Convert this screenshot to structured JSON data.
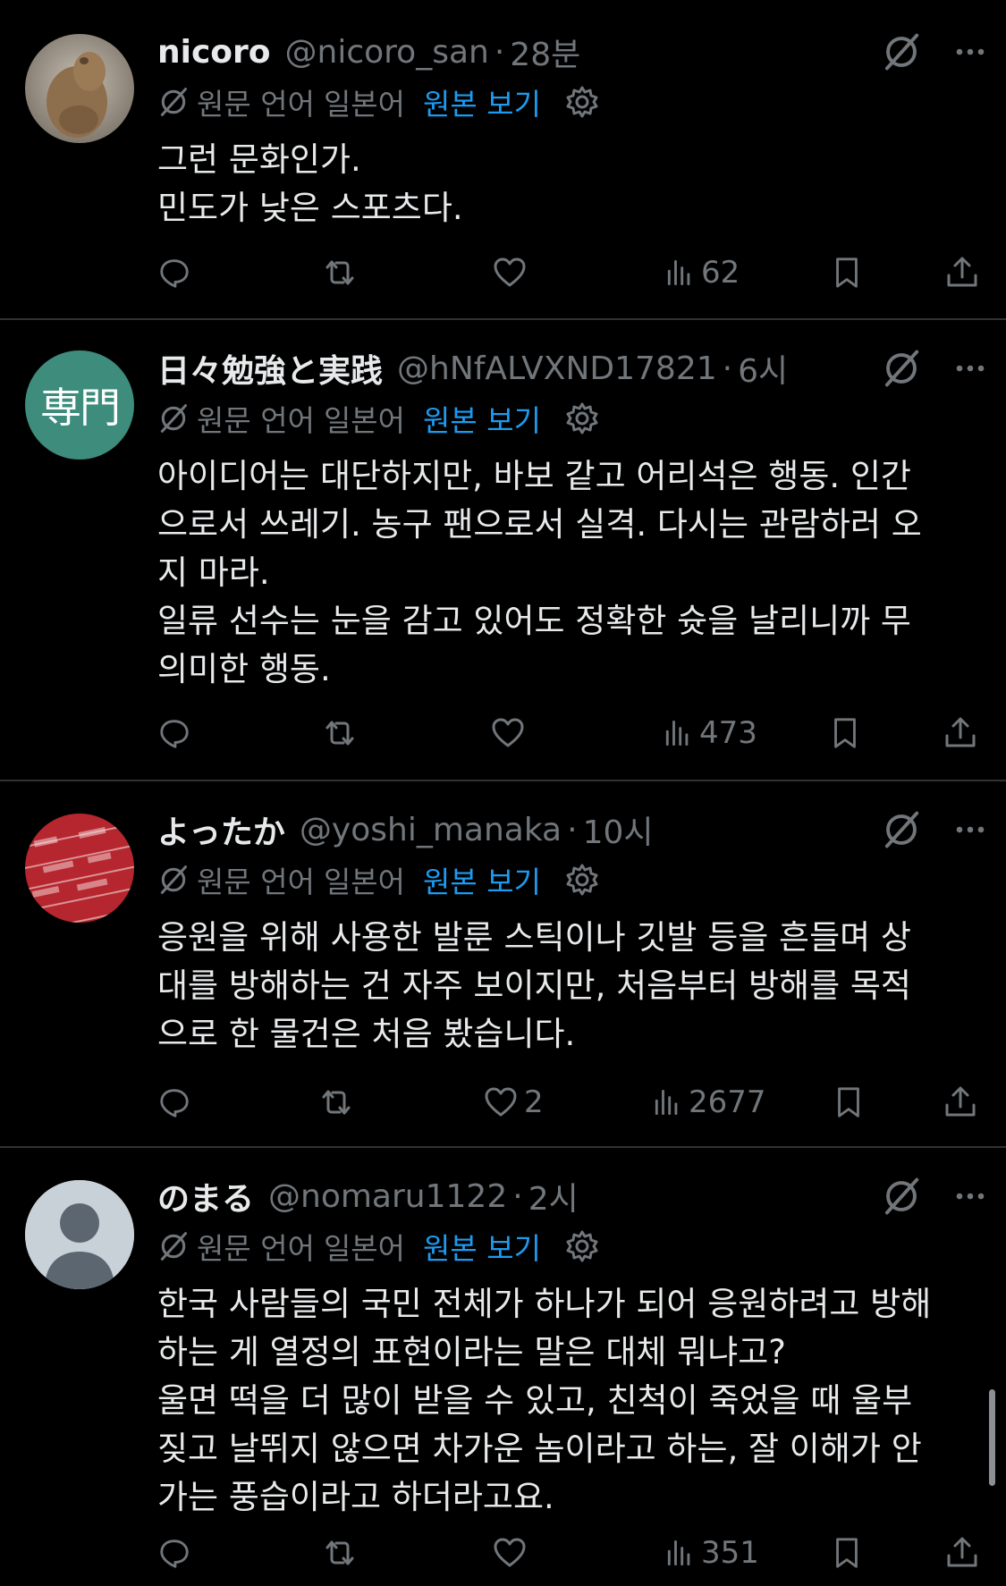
{
  "colors": {
    "background": "#000000",
    "text": "#e7e9ea",
    "muted": "#71767b",
    "link": "#1d9bf0",
    "divider": "#2f3336"
  },
  "posts": [
    {
      "name": "nicoro",
      "handle": "@nicoro_san",
      "time": "28분",
      "avatar": "capybara-photo",
      "translate": {
        "label": "원문 언어",
        "lang": "일본어",
        "link": "원본 보기"
      },
      "text": "그런 문화인가.\n민도가 낮은 스포츠다.",
      "stats": {
        "replies": "",
        "reposts": "",
        "likes": "",
        "views": "62"
      }
    },
    {
      "name": "日々勉強と実践",
      "handle": "@hNfALVXND17821",
      "time": "6시",
      "avatar": "text-avatar",
      "avatar_text": "専門",
      "translate": {
        "label": "원문 언어",
        "lang": "일본어",
        "link": "원본 보기"
      },
      "text": "아이디어는 대단하지만, 바보 같고 어리석은 행동. 인간\n으로서 쓰레기. 농구 팬으로서 실격. 다시는 관람하러 오\n지 마라.\n일류 선수는 눈을 감고 있어도 정확한 슛을 날리니까 무\n의미한 행동.",
      "stats": {
        "replies": "",
        "reposts": "",
        "likes": "",
        "views": "473"
      }
    },
    {
      "name": "よったか",
      "handle": "@yoshi_manaka",
      "time": "10시",
      "avatar": "tamiya-logo-pattern",
      "translate": {
        "label": "원문 언어",
        "lang": "일본어",
        "link": "원본 보기"
      },
      "text": "응원을 위해 사용한 발룬 스틱이나 깃발 등을 흔들며 상\n대를 방해하는 건 자주 보이지만, 처음부터 방해를 목적\n으로 한 물건은 처음 봤습니다.",
      "stats": {
        "replies": "",
        "reposts": "",
        "likes": "2",
        "views": "2677"
      }
    },
    {
      "name": "のまる",
      "handle": "@nomaru1122",
      "time": "2시",
      "avatar": "default-person",
      "translate": {
        "label": "원문 언어",
        "lang": "일본어",
        "link": "원본 보기"
      },
      "text": "한국 사람들의 국민 전체가 하나가 되어 응원하려고 방해\n하는 게 열정의 표현이라는 말은 대체 뭐냐고?\n울면 떡을 더 많이 받을 수 있고, 친척이 죽었을 때 울부\n짖고 날뛰지 않으면 차가운 놈이라고 하는, 잘 이해가 안\n가는 풍습이라고 하더라고요.",
      "stats": {
        "replies": "",
        "reposts": "",
        "likes": "",
        "views": "351"
      }
    }
  ]
}
